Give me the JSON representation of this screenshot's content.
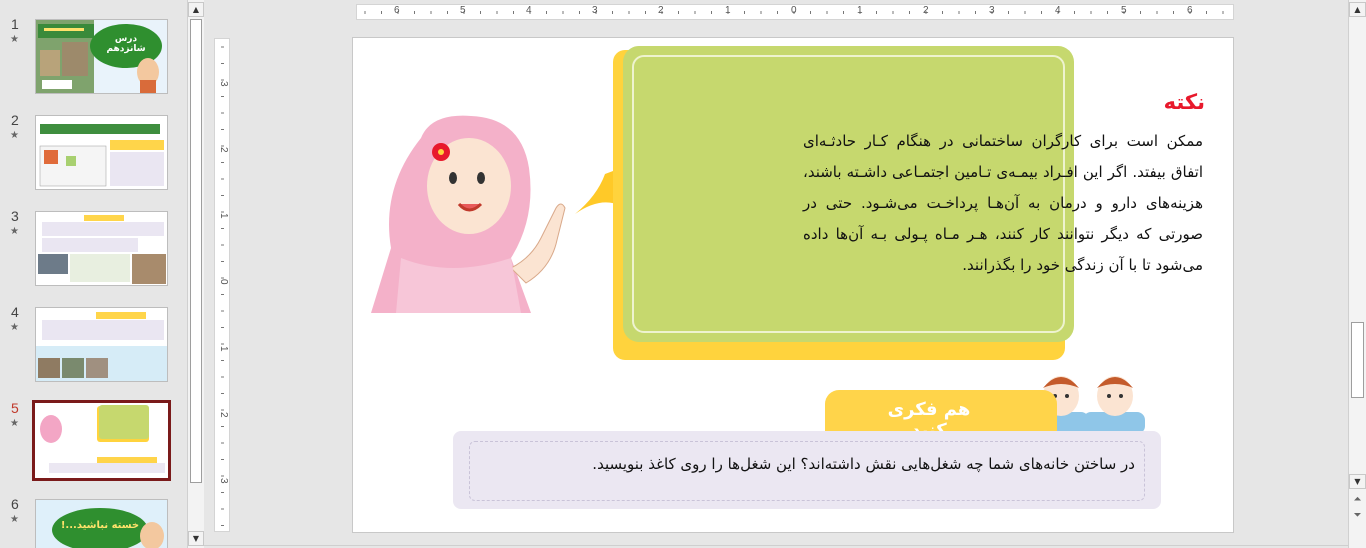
{
  "thumbnails": [
    {
      "number": "1",
      "star": "★",
      "title": "درس شانزدهم"
    },
    {
      "number": "2",
      "star": "★"
    },
    {
      "number": "3",
      "star": "★"
    },
    {
      "number": "4",
      "star": "★"
    },
    {
      "number": "5",
      "star": "★",
      "selected": true
    },
    {
      "number": "6",
      "star": "★",
      "title": "خسته نباشید...!"
    }
  ],
  "ruler": {
    "horizontal_labels": [
      "6",
      "5",
      "4",
      "3",
      "2",
      "1",
      "0",
      "1",
      "2",
      "3",
      "4",
      "5",
      "6"
    ],
    "vertical_labels": [
      "3",
      "2",
      "1",
      "0",
      "1",
      "2",
      "3"
    ]
  },
  "slide": {
    "note": {
      "title": "نکته",
      "body": "ممکن است برای کارگران ساختمانی در هنگام کـار حادثـه‌ای اتفاق بیفتد. اگر این افـراد بیمـه‌ی تـامین اجتمـاعی داشـته باشند، هزینه‌های دارو و درمان به آن‌هـا پرداخـت می‌شـود. حتی در صورتی که دیگر نتوانند کار کنند، هـر مـاه پـولی بـه آن‌ها داده می‌شود تا با آن زندگی خود را بگذرانند."
    },
    "think": {
      "title": "هم فکری کنید",
      "text": "در ساختن خانه‌های شما چه شغل‌هایی نقش داشته‌اند؟ این شغل‌ها را روی کاغذ بنویسید."
    }
  },
  "colors": {
    "note_card": "#c6d86e",
    "note_title": "#e8192c",
    "accent_yellow": "#ffd33d",
    "think_box": "#ebe7f2",
    "selected_border": "#7a1a1a"
  }
}
